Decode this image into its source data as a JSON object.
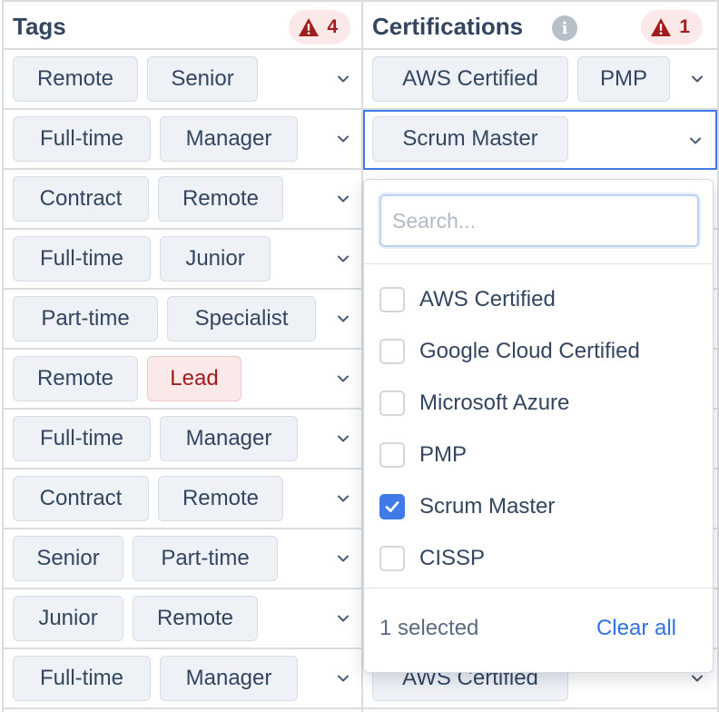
{
  "tags_column": {
    "title": "Tags",
    "warning_count": "4"
  },
  "certs_column": {
    "title": "Certifications",
    "info_glyph": "i",
    "warning_count": "1"
  },
  "rows": [
    {
      "tags": [
        {
          "label": "Remote"
        },
        {
          "label": "Senior"
        }
      ],
      "certs": [
        {
          "label": "AWS Certified"
        },
        {
          "label": "PMP"
        }
      ]
    },
    {
      "tags": [
        {
          "label": "Full-time"
        },
        {
          "label": "Manager"
        }
      ],
      "certs": [
        {
          "label": "Scrum Master"
        }
      ]
    },
    {
      "tags": [
        {
          "label": "Contract"
        },
        {
          "label": "Remote"
        }
      ],
      "certs": []
    },
    {
      "tags": [
        {
          "label": "Full-time"
        },
        {
          "label": "Junior"
        }
      ],
      "certs": []
    },
    {
      "tags": [
        {
          "label": "Part-time"
        },
        {
          "label": "Specialist"
        }
      ],
      "certs": []
    },
    {
      "tags": [
        {
          "label": "Remote"
        },
        {
          "label": "Lead",
          "warning": true
        }
      ],
      "certs": []
    },
    {
      "tags": [
        {
          "label": "Full-time"
        },
        {
          "label": "Manager"
        }
      ],
      "certs": []
    },
    {
      "tags": [
        {
          "label": "Contract"
        },
        {
          "label": "Remote"
        }
      ],
      "certs": []
    },
    {
      "tags": [
        {
          "label": "Senior"
        },
        {
          "label": "Part-time"
        }
      ],
      "certs": []
    },
    {
      "tags": [
        {
          "label": "Junior"
        },
        {
          "label": "Remote"
        }
      ],
      "certs": []
    },
    {
      "tags": [
        {
          "label": "Full-time"
        },
        {
          "label": "Manager"
        }
      ],
      "certs": [
        {
          "label": "AWS Certified"
        }
      ]
    }
  ],
  "dropdown": {
    "search_placeholder": "Search...",
    "options": [
      {
        "label": "AWS Certified",
        "checked": false
      },
      {
        "label": "Google Cloud Certified",
        "checked": false
      },
      {
        "label": "Microsoft Azure",
        "checked": false
      },
      {
        "label": "PMP",
        "checked": false
      },
      {
        "label": "Scrum Master",
        "checked": true
      },
      {
        "label": "CISSP",
        "checked": false
      }
    ],
    "selected_count_text": "1 selected",
    "clear_all_label": "Clear all"
  },
  "colors": {
    "accent": "#3f7ae6",
    "warning": "#a11d1d",
    "chip_bg": "#eef2f7"
  }
}
